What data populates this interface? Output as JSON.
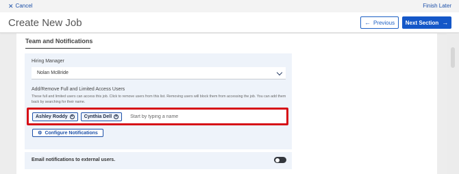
{
  "topbar": {
    "cancel_label": "Cancel",
    "finish_later_label": "Finish Later"
  },
  "header": {
    "title": "Create New Job",
    "previous_label": "Previous",
    "next_label": "Next Section"
  },
  "section": {
    "title": "Team and Notifications"
  },
  "hiring_manager": {
    "label": "Hiring Manager",
    "value": "Nolan McBride"
  },
  "access_users": {
    "label": "Add/Remove Full and Limited Access Users",
    "help": "These full and limited users can access this job. Click to remove users from this list. Removing users will block them from accessing the job. You can add them back by searching for their name.",
    "chips": [
      {
        "label": "Ashley Roddy"
      },
      {
        "label": "Cynthia Dell"
      }
    ],
    "input_placeholder": "Start by typing a name"
  },
  "configure_notifications_label": "Configure Notifications",
  "email_notifications": {
    "label": "Email notifications to external users.",
    "enabled": false
  },
  "colors": {
    "primary": "#1457c8",
    "highlight": "#d60c16",
    "panel_bg": "#eef3fa"
  }
}
